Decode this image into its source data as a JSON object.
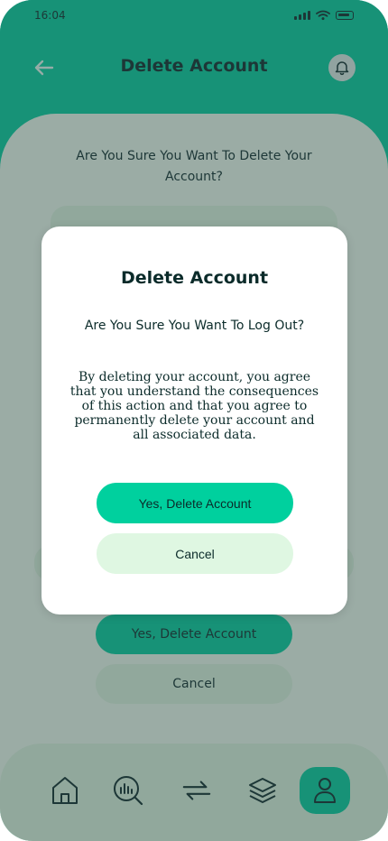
{
  "status_bar": {
    "time": "16:04"
  },
  "header": {
    "title": "Delete Account"
  },
  "base_screen": {
    "question": "Are You Sure You Want To Delete Your Account?",
    "yes_label": "Yes, Delete Account",
    "cancel_label": "Cancel"
  },
  "modal": {
    "title": "Delete Account",
    "question": "Are You Sure You Want To Log Out?",
    "body": "By deleting your account, you agree that you understand the consequences of this action and that you agree to permanently delete your account and all associated data.",
    "yes_label": "Yes, Delete Account",
    "cancel_label": "Cancel"
  },
  "bottom_nav": {
    "items": [
      {
        "icon": "home-icon"
      },
      {
        "icon": "analysis-icon"
      },
      {
        "icon": "transactions-icon"
      },
      {
        "icon": "layers-icon"
      },
      {
        "icon": "profile-icon",
        "active": true
      }
    ]
  },
  "colors": {
    "primary": "#00D09E",
    "background": "#F1FFF3",
    "surface_light": "#DFF7E2",
    "text_dark": "#0b2b2a",
    "dim_overlay": "rgba(50,70,70,0.45)"
  }
}
